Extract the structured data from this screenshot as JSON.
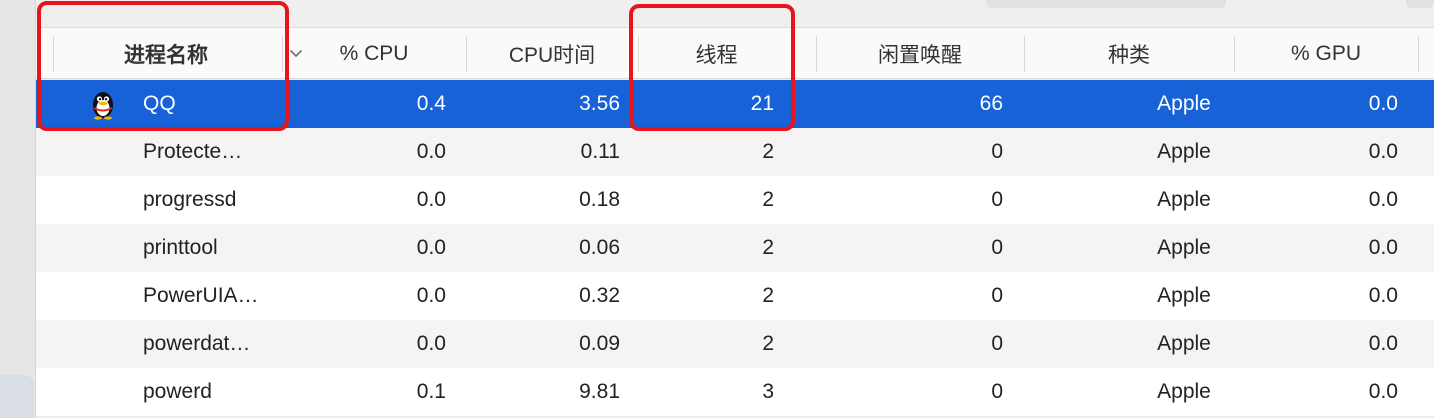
{
  "header": {
    "columns": [
      {
        "label": "进程名称"
      },
      {
        "label": "% CPU"
      },
      {
        "label": "CPU时间"
      },
      {
        "label": "线程"
      },
      {
        "label": "闲置唤醒"
      },
      {
        "label": "种类"
      },
      {
        "label": "% GPU"
      }
    ],
    "sort_icon": "chevron-down-icon"
  },
  "rows": [
    {
      "name": "QQ",
      "cpu": "0.4",
      "cpu_time": "3.56",
      "threads": "21",
      "idle_wakeups": "66",
      "kind": "Apple",
      "gpu": "0.0",
      "icon": "qq-penguin-icon",
      "selected": true
    },
    {
      "name": "Protecte…",
      "cpu": "0.0",
      "cpu_time": "0.11",
      "threads": "2",
      "idle_wakeups": "0",
      "kind": "Apple",
      "gpu": "0.0"
    },
    {
      "name": "progressd",
      "cpu": "0.0",
      "cpu_time": "0.18",
      "threads": "2",
      "idle_wakeups": "0",
      "kind": "Apple",
      "gpu": "0.0"
    },
    {
      "name": "printtool",
      "cpu": "0.0",
      "cpu_time": "0.06",
      "threads": "2",
      "idle_wakeups": "0",
      "kind": "Apple",
      "gpu": "0.0"
    },
    {
      "name": "PowerUIA…",
      "cpu": "0.0",
      "cpu_time": "0.32",
      "threads": "2",
      "idle_wakeups": "0",
      "kind": "Apple",
      "gpu": "0.0"
    },
    {
      "name": "powerdat…",
      "cpu": "0.0",
      "cpu_time": "0.09",
      "threads": "2",
      "idle_wakeups": "0",
      "kind": "Apple",
      "gpu": "0.0"
    },
    {
      "name": "powerd",
      "cpu": "0.1",
      "cpu_time": "9.81",
      "threads": "3",
      "idle_wakeups": "0",
      "kind": "Apple",
      "gpu": "0.0"
    }
  ],
  "colors": {
    "selection": "#1762d6",
    "annotation": "#e8141c"
  }
}
